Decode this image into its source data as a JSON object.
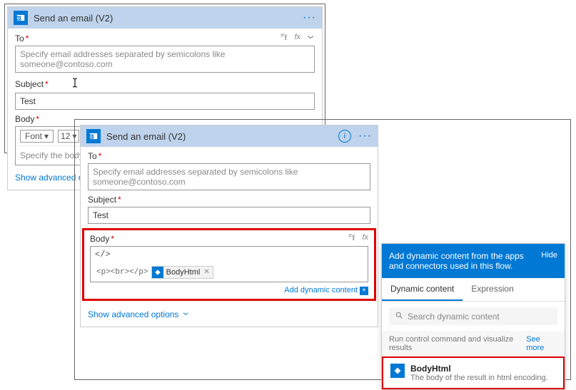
{
  "card1": {
    "title": "Send an email (V2)",
    "to_label": "To",
    "to_placeholder": "Specify email addresses separated by semicolons like someone@contoso.com",
    "subject_label": "Subject",
    "subject_value": "Test",
    "body_label": "Body",
    "font_label": "Font",
    "font_size": "12",
    "body_placeholder": "Specify the body of the",
    "advanced": "Show advanced options"
  },
  "card2": {
    "title": "Send an email (V2)",
    "to_label": "To",
    "to_placeholder": "Specify email addresses separated by semicolons like someone@contoso.com",
    "subject_label": "Subject",
    "subject_value": "Test",
    "body_label": "Body",
    "body_code_line": "</>",
    "body_html_prefix": "<p><br></p>",
    "token_name": "BodyHtml",
    "add_dynamic": "Add dynamic content",
    "advanced": "Show advanced options"
  },
  "dynamic": {
    "header_text": "Add dynamic content from the apps and connectors used in this flow.",
    "hide": "Hide",
    "tab_dynamic": "Dynamic content",
    "tab_expression": "Expression",
    "search_placeholder": "Search dynamic content",
    "section_title": "Run control command and visualize results",
    "see_more": "See more",
    "item_name": "BodyHtml",
    "item_desc": "The body of the result in html encoding."
  }
}
